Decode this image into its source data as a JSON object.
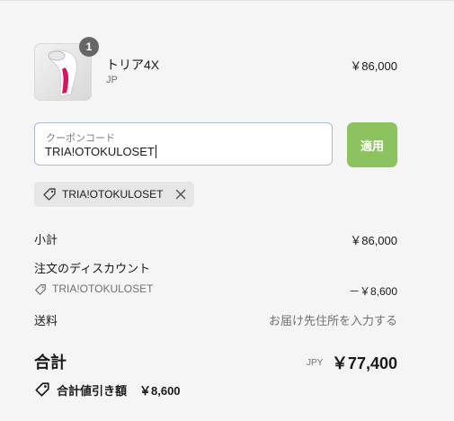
{
  "product": {
    "name": "トリア4X",
    "variant": "JP",
    "price": "￥86,000",
    "quantity": "1",
    "image_icon": "hair-removal-device-thumbnail"
  },
  "coupon": {
    "label": "クーポンコード",
    "value": "TRIA!OTOKULOSET",
    "apply_label": "適用"
  },
  "applied_tag": {
    "code": "TRIA!OTOKULOSET",
    "tag_icon": "tag-icon",
    "remove_icon": "close-icon"
  },
  "summary": {
    "subtotal_label": "小計",
    "subtotal_value": "￥86,000",
    "discount_label": "注文のディスカウント",
    "discount_code": "TRIA!OTOKULOSET",
    "discount_value": "－￥8,600",
    "shipping_label": "送料",
    "shipping_value": "お届け先住所を入力する",
    "total_label": "合計",
    "total_currency": "JPY",
    "total_value": "￥77,400",
    "savings_label": "合計値引き額",
    "savings_value": "￥8,600"
  },
  "colors": {
    "apply_button": "#8cc35e",
    "field_border": "#a9bcd3",
    "badge": "#666666",
    "product_accent": "#e0105f"
  }
}
